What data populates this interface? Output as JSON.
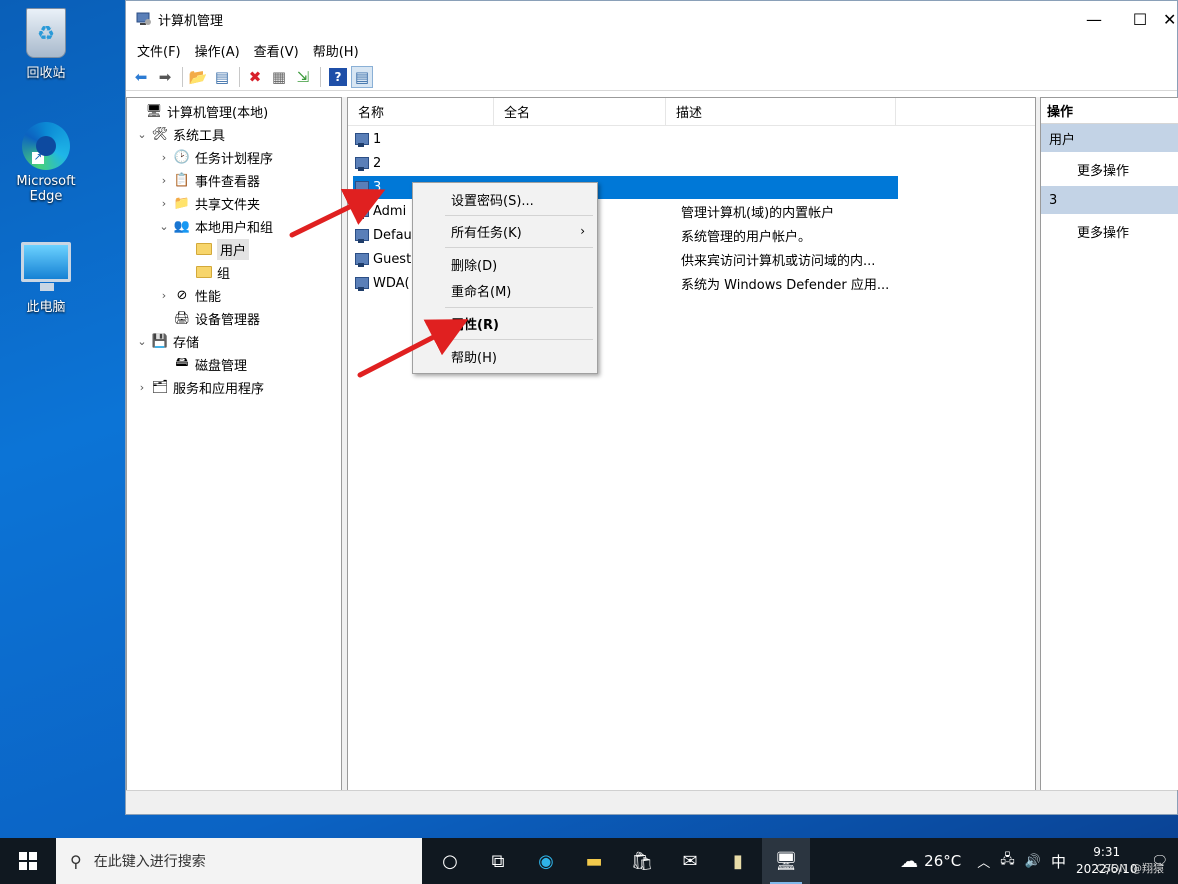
{
  "desktop": {
    "icons": [
      {
        "label": "回收站"
      },
      {
        "label": "Microsoft\nEdge"
      },
      {
        "label": "此电脑"
      }
    ]
  },
  "window": {
    "title": "计算机管理",
    "controls": {
      "minimize": "—",
      "maximize": "☐",
      "close": "✕"
    },
    "menu": [
      "文件(F)",
      "操作(A)",
      "查看(V)",
      "帮助(H)"
    ]
  },
  "tree": {
    "items": [
      {
        "label": "计算机管理(本地)",
        "arrow": "",
        "icon": "🖥"
      },
      {
        "label": "系统工具",
        "arrow": "⌄",
        "icon": "🛠"
      },
      {
        "label": "任务计划程序",
        "arrow": "›",
        "icon": "🕑"
      },
      {
        "label": "事件查看器",
        "arrow": "›",
        "icon": "📋"
      },
      {
        "label": "共享文件夹",
        "arrow": "›",
        "icon": "📁"
      },
      {
        "label": "本地用户和组",
        "arrow": "⌄",
        "icon": "👥"
      },
      {
        "label": "用户",
        "arrow": "",
        "icon": "folder"
      },
      {
        "label": "组",
        "arrow": "",
        "icon": "folder"
      },
      {
        "label": "性能",
        "arrow": "›",
        "icon": "⊘"
      },
      {
        "label": "设备管理器",
        "arrow": "",
        "icon": "🖨"
      },
      {
        "label": "存储",
        "arrow": "⌄",
        "icon": "💾"
      },
      {
        "label": "磁盘管理",
        "arrow": "",
        "icon": "🖴"
      },
      {
        "label": "服务和应用程序",
        "arrow": "›",
        "icon": "🗂"
      }
    ]
  },
  "list": {
    "columns": [
      "名称",
      "全名",
      "描述"
    ],
    "rows": [
      {
        "name": "1",
        "desc": ""
      },
      {
        "name": "2",
        "desc": ""
      },
      {
        "name": "3",
        "desc": ""
      },
      {
        "name": "Admi",
        "desc": "管理计算机(域)的内置帐户"
      },
      {
        "name": "Defau",
        "desc": "系统管理的用户帐户。"
      },
      {
        "name": "Guest",
        "desc": "供来宾访问计算机或访问域的内..."
      },
      {
        "name": "WDA(",
        "desc": "系统为 Windows Defender 应用..."
      }
    ]
  },
  "context_menu": {
    "items": [
      {
        "label": "设置密码(S)..."
      },
      {
        "label": "所有任务(K)",
        "submenu": "›"
      },
      {
        "label": "删除(D)"
      },
      {
        "label": "重命名(M)"
      },
      {
        "label": "属性(R)"
      },
      {
        "label": "帮助(H)"
      }
    ]
  },
  "actions": {
    "header": "操作",
    "sections": [
      {
        "title": "用户",
        "item": "更多操作"
      },
      {
        "title": "3",
        "item": "更多操作"
      }
    ]
  },
  "taskbar": {
    "search_placeholder": "在此键入进行搜索",
    "weather": "26°C",
    "ime": "中",
    "time": "9:31",
    "date": "2022/6/10",
    "watermark": "CSDN @翔猿"
  },
  "colors": {
    "selection": "#0078d7",
    "arrow": "#e02020",
    "actions_section": "#c3d3e6"
  }
}
